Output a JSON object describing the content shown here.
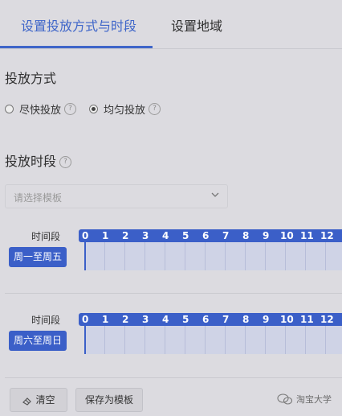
{
  "tabs": [
    {
      "label": "设置投放方式与时段",
      "active": true
    },
    {
      "label": "设置地域",
      "active": false
    }
  ],
  "delivery_mode": {
    "title": "投放方式",
    "options": [
      {
        "label": "尽快投放",
        "selected": false
      },
      {
        "label": "均匀投放",
        "selected": true
      }
    ]
  },
  "time_slot": {
    "title": "投放时段",
    "template_placeholder": "请选择模板"
  },
  "schedule": {
    "row_label": "时间段",
    "hours": [
      "0",
      "1",
      "2",
      "3",
      "4",
      "5",
      "6",
      "7",
      "8",
      "9",
      "10",
      "11",
      "12"
    ],
    "blocks": [
      {
        "day_label": "周一至周五"
      },
      {
        "day_label": "周六至周日"
      }
    ]
  },
  "footer": {
    "clear_label": "清空",
    "save_template_label": "保存为模板"
  },
  "watermark": "淘宝大学",
  "colors": {
    "accent": "#3f66c9",
    "ruler": "#3b5fc8",
    "background": "#dcdbe0"
  }
}
